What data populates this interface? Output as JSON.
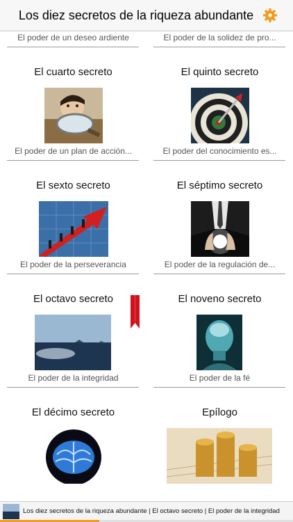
{
  "nav": {
    "title": "Los diez secretos de la riqueza abundante",
    "settings_icon": "gear-icon",
    "accent_color": "#f39a1c"
  },
  "secrets": [
    {
      "title": "",
      "subtitle": "El poder de un deseo ardiente",
      "image": "crowd-hands-thumbnail"
    },
    {
      "title": "",
      "subtitle": "El poder de la solidez de pro...",
      "image": "walking-figure-thumbnail"
    },
    {
      "title": "El cuarto secreto",
      "subtitle": "El poder de un plan de acción...",
      "image": "child-with-magnifier-thumbnail"
    },
    {
      "title": "El quinto secreto",
      "subtitle": "El poder del conocimiento es...",
      "image": "dart-on-target-thumbnail"
    },
    {
      "title": "El sexto secreto",
      "subtitle": "El poder de la perseverancia",
      "image": "climbing-arrow-chart-thumbnail"
    },
    {
      "title": "El séptimo secreto",
      "subtitle": "El poder de la regulación de...",
      "image": "hands-with-glowing-light-thumbnail"
    },
    {
      "title": "El octavo secreto",
      "subtitle": "El poder de la integridad",
      "image": "sea-horizon-thumbnail"
    },
    {
      "title": "El noveno secreto",
      "subtitle": "El poder de la fé",
      "image": "glowing-head-thumbnail"
    },
    {
      "title": "El décimo secreto",
      "subtitle": "",
      "image": "blue-brain-thumbnail"
    },
    {
      "title": "Epílogo",
      "subtitle": "",
      "image": "gold-coins-thumbnail"
    }
  ],
  "bookmark": {
    "icon": "bookmark-ribbon-icon",
    "color": "#d0121c"
  },
  "now_playing": {
    "text": "Los diez secretos de la riqueza abundante | El octavo secreto | El poder de la integridad",
    "progress": 0.34
  }
}
